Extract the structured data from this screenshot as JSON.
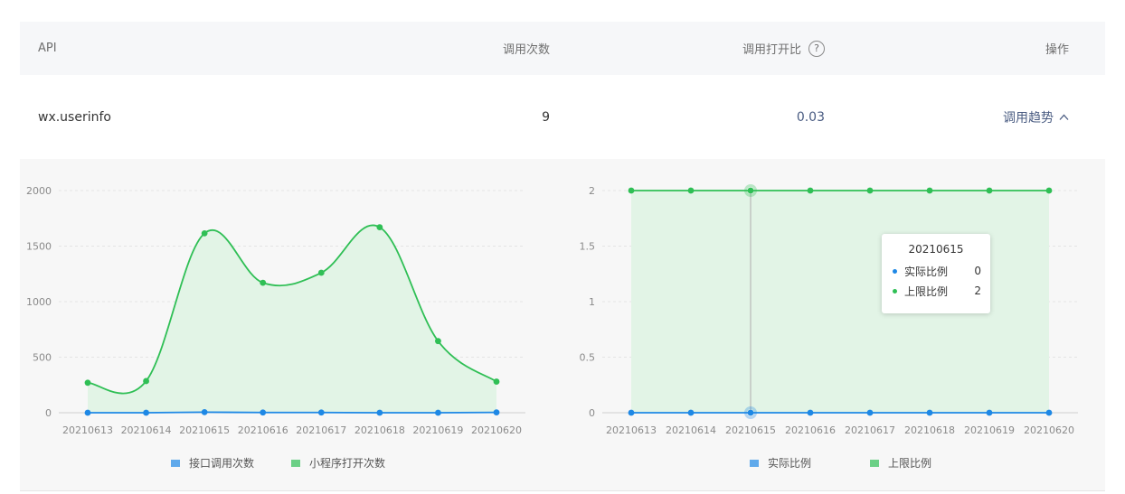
{
  "table": {
    "headers": {
      "api": "API",
      "calls": "调用次数",
      "ratio": "调用打开比",
      "actions": "操作"
    },
    "help_icon_glyph": "?",
    "row": {
      "api": "wx.userinfo",
      "calls": "9",
      "ratio": "0.03",
      "action": "调用趋势",
      "action_icon": "chevron-up-icon"
    }
  },
  "colors": {
    "blue": "#1e88e5",
    "green": "#2fbf55",
    "green_fill": "#e2f4e6",
    "link": "#4a5c82"
  },
  "chart_data": [
    {
      "type": "line",
      "x": [
        "20210613",
        "20210614",
        "20210615",
        "20210616",
        "20210617",
        "20210618",
        "20210619",
        "20210620"
      ],
      "ylim": [
        0,
        2000
      ],
      "yticks": [
        "0",
        "500",
        "1000",
        "1500",
        "2000"
      ],
      "grid": true,
      "legend": "bottom-center",
      "series": [
        {
          "name": "接口调用次数",
          "values": [
            0,
            0,
            5,
            2,
            2,
            0,
            0,
            3
          ],
          "color": "#1e88e5",
          "area": false
        },
        {
          "name": "小程序打开次数",
          "values": [
            270,
            285,
            1615,
            1170,
            1260,
            1670,
            645,
            280
          ],
          "color": "#2fbf55",
          "area": true
        }
      ]
    },
    {
      "type": "line",
      "x": [
        "20210613",
        "20210614",
        "20210615",
        "20210616",
        "20210617",
        "20210618",
        "20210619",
        "20210620"
      ],
      "ylim": [
        0,
        2
      ],
      "yticks": [
        "0",
        "0.5",
        "1",
        "1.5",
        "2"
      ],
      "grid": true,
      "legend": "bottom-center",
      "series": [
        {
          "name": "实际比例",
          "values": [
            0,
            0,
            0,
            0,
            0,
            0,
            0,
            0
          ],
          "color": "#1e88e5",
          "area": false
        },
        {
          "name": "上限比例",
          "values": [
            2,
            2,
            2,
            2,
            2,
            2,
            2,
            2
          ],
          "color": "#2fbf55",
          "area": true
        }
      ],
      "tooltip": {
        "title": "20210615",
        "rows": [
          {
            "label": "实际比例",
            "value": "0"
          },
          {
            "label": "上限比例",
            "value": "2"
          }
        ]
      }
    }
  ]
}
